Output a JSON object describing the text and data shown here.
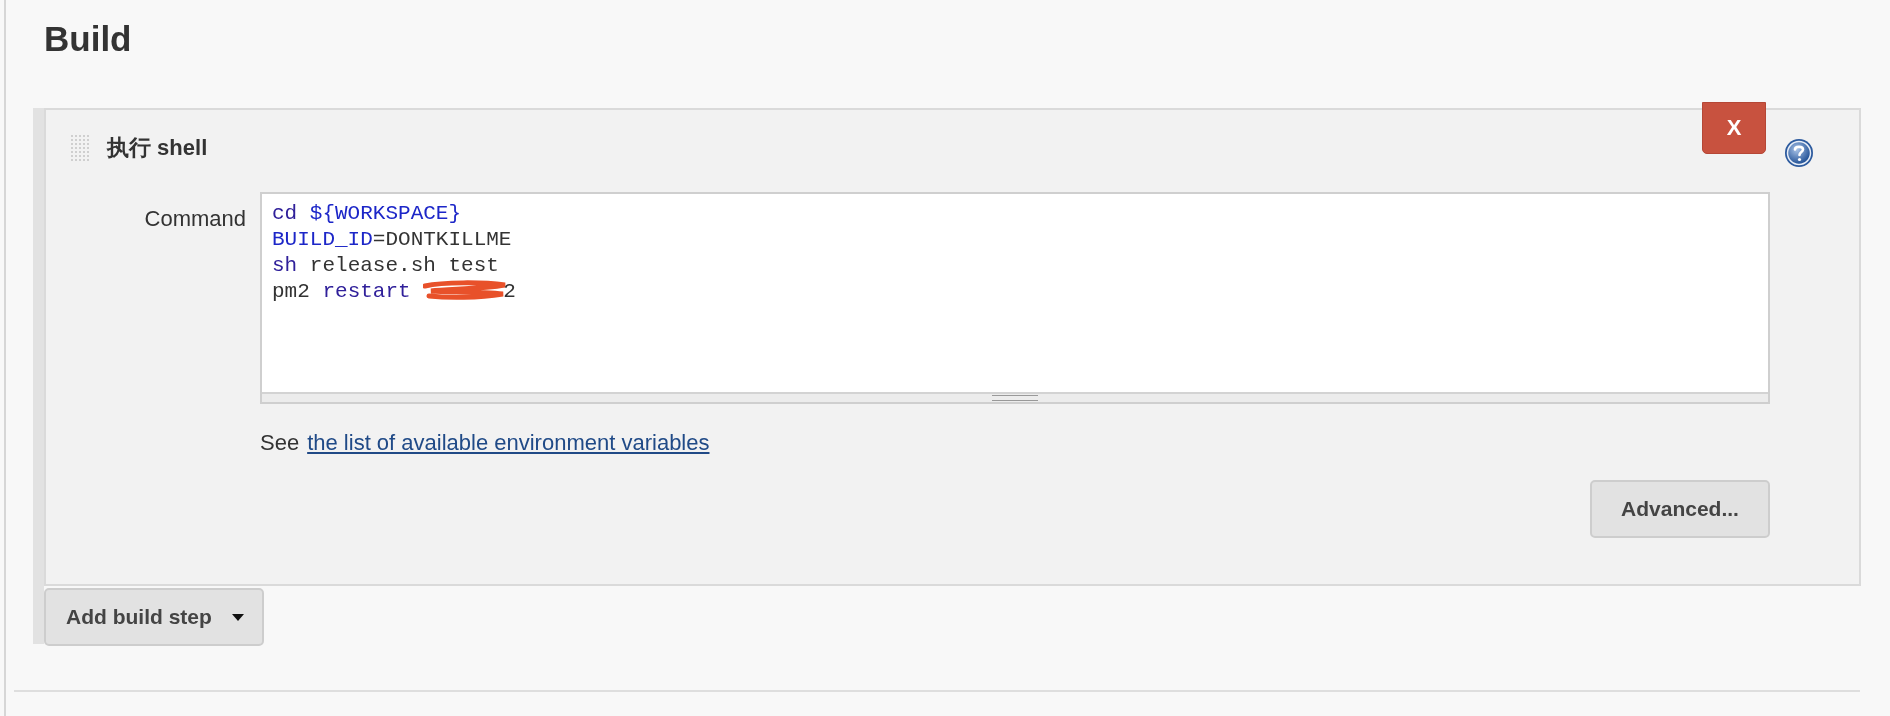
{
  "section": {
    "title": "Build"
  },
  "build_step": {
    "title": "执行 shell",
    "delete_button": "X",
    "command": {
      "label": "Command",
      "lines": [
        [
          {
            "kind": "builtin",
            "text": "cd "
          },
          {
            "kind": "variable",
            "text": "${WORKSPACE}"
          }
        ],
        [
          {
            "kind": "variable",
            "text": "BUILD_ID"
          },
          {
            "kind": "plain",
            "text": "=DONTKILLME"
          }
        ],
        [
          {
            "kind": "builtin",
            "text": "sh"
          },
          {
            "kind": "plain",
            "text": " release.sh test"
          }
        ],
        [
          {
            "kind": "plain",
            "text": "pm2 "
          },
          {
            "kind": "builtin",
            "text": "restart "
          },
          {
            "kind": "redaction"
          },
          {
            "kind": "plain",
            "text": "2"
          }
        ]
      ]
    },
    "hint": {
      "prefix": "See",
      "link": "the list of available environment variables"
    },
    "advanced_button": "Advanced..."
  },
  "add_button": "Add build step"
}
